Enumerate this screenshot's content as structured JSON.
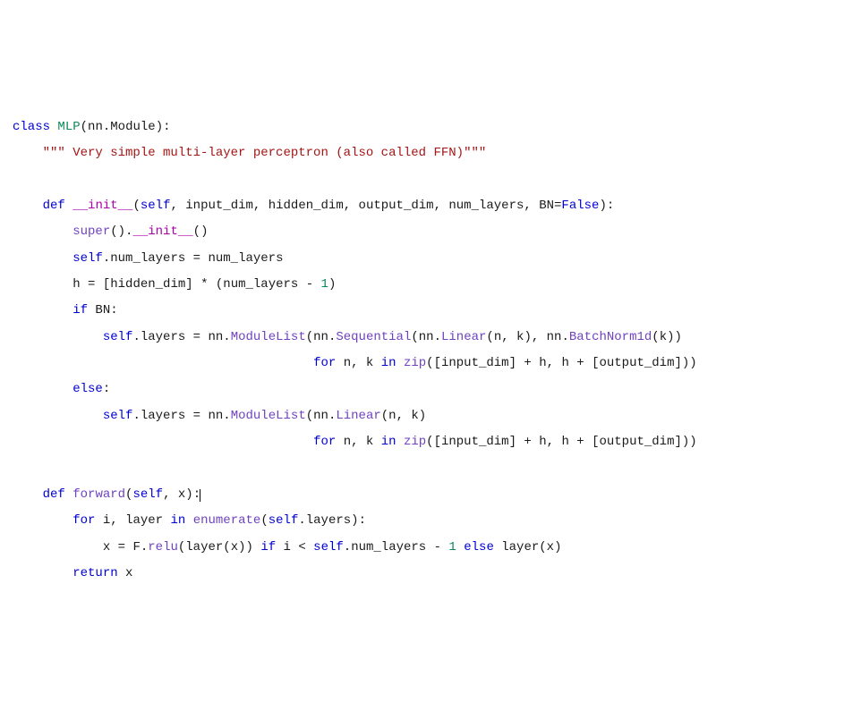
{
  "code": {
    "l1": {
      "kw_class": "class",
      "name": "MLP",
      "paren1": "(",
      "nn": "nn",
      "dot": ".",
      "module": "Module",
      "paren2": ")",
      "colon": ":"
    },
    "l2": {
      "docstring": "\"\"\" Very simple multi-layer perceptron (also called FFN)\"\"\""
    },
    "l3": {
      "kw_def": "def",
      "name": "__init__",
      "paren1": "(",
      "self": "self",
      "c1": ", ",
      "a1": "input_dim",
      "c2": ", ",
      "a2": "hidden_dim",
      "c3": ", ",
      "a3": "output_dim",
      "c4": ", ",
      "a4": "num_layers",
      "c5": ", ",
      "a5": "BN",
      "eq": "=",
      "false": "False",
      "paren2": ")",
      "colon": ":"
    },
    "l4": {
      "super": "super",
      "p1": "()",
      "dot": ".",
      "init": "__init__",
      "p2": "()"
    },
    "l5": {
      "self": "self",
      "dot": ".",
      "attr": "num_layers",
      "eq": " = ",
      "val": "num_layers"
    },
    "l6": {
      "h": "h",
      "eq": " = ",
      "br1": "[",
      "hd": "hidden_dim",
      "br2": "]",
      "mul": " * ",
      "p1": "(",
      "nl": "num_layers",
      "sub": " - ",
      "one": "1",
      "p2": ")"
    },
    "l7": {
      "kw_if": "if",
      "cond": " BN",
      "colon": ":"
    },
    "l8": {
      "self": "self",
      "dot": ".",
      "layers": "layers",
      "eq": " = ",
      "nn1": "nn",
      "d1": ".",
      "ml": "ModuleList",
      "p1": "(",
      "nn2": "nn",
      "d2": ".",
      "seq": "Sequential",
      "p2": "(",
      "nn3": "nn",
      "d3": ".",
      "lin": "Linear",
      "p3": "(",
      "n": "n",
      "c1": ", ",
      "k": "k",
      "p4": ")",
      "c2": ", ",
      "nn4": "nn",
      "d4": ".",
      "bn": "BatchNorm1d",
      "p5": "(",
      "k2": "k",
      "p6": "))"
    },
    "l9": {
      "kw_for": "for",
      "sp1": " ",
      "n": "n",
      "c1": ", ",
      "k": "k",
      "sp2": " ",
      "kw_in": "in",
      "sp3": " ",
      "zip": "zip",
      "p1": "(",
      "br1": "[",
      "id": "input_dim",
      "br2": "]",
      "plus1": " + ",
      "h1": "h",
      "c2": ", ",
      "h2": "h",
      "plus2": " + ",
      "br3": "[",
      "od": "output_dim",
      "br4": "]",
      "p2": "))"
    },
    "l10": {
      "kw_else": "else",
      "colon": ":"
    },
    "l11": {
      "self": "self",
      "dot": ".",
      "layers": "layers",
      "eq": " = ",
      "nn1": "nn",
      "d1": ".",
      "ml": "ModuleList",
      "p1": "(",
      "nn2": "nn",
      "d2": ".",
      "lin": "Linear",
      "p2": "(",
      "n": "n",
      "c1": ", ",
      "k": "k",
      "p3": ")"
    },
    "l12": {
      "kw_for": "for",
      "sp1": " ",
      "n": "n",
      "c1": ", ",
      "k": "k",
      "sp2": " ",
      "kw_in": "in",
      "sp3": " ",
      "zip": "zip",
      "p1": "(",
      "br1": "[",
      "id": "input_dim",
      "br2": "]",
      "plus1": " + ",
      "h1": "h",
      "c2": ", ",
      "h2": "h",
      "plus2": " + ",
      "br3": "[",
      "od": "output_dim",
      "br4": "]",
      "p2": "))"
    },
    "l13": {
      "kw_def": "def",
      "name": "forward",
      "p1": "(",
      "self": "self",
      "c1": ", ",
      "x": "x",
      "p2": ")",
      "colon": ":"
    },
    "l14": {
      "kw_for": "for",
      "sp1": " ",
      "i": "i",
      "c1": ", ",
      "layer": "layer",
      "sp2": " ",
      "kw_in": "in",
      "sp3": " ",
      "enum": "enumerate",
      "p1": "(",
      "self": "self",
      "dot": ".",
      "layers": "layers",
      "p2": ")",
      "colon": ":"
    },
    "l15": {
      "x1": "x",
      "eq": " = ",
      "F": "F",
      "dot": ".",
      "relu": "relu",
      "p1": "(",
      "layer1": "layer",
      "p2": "(",
      "x2": "x",
      "p3": "))",
      "sp1": " ",
      "kw_if": "if",
      "sp2": " ",
      "i": "i",
      "lt": " < ",
      "self": "self",
      "d2": ".",
      "nl": "num_layers",
      "sub": " - ",
      "one": "1",
      "sp3": " ",
      "kw_else": "else",
      "sp4": " ",
      "layer2": "layer",
      "p4": "(",
      "x3": "x",
      "p5": ")"
    },
    "l16": {
      "kw_return": "return",
      "sp": " ",
      "x": "x"
    }
  }
}
